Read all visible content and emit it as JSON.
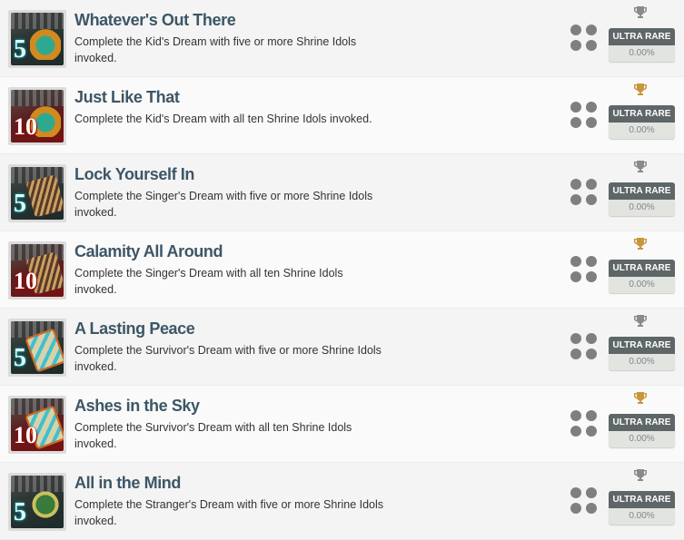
{
  "colors": {
    "trophy_silver": "#8a8a8a",
    "trophy_gold": "#c8963e",
    "badge": "#5f6668",
    "title": "#3d5666"
  },
  "achievements": [
    {
      "title": "Whatever's Out There",
      "description": "Complete the Kid's Dream with five or more Shrine Idols invoked.",
      "icon_number": "5",
      "icon_subject": "kid",
      "trophy": "silver",
      "rarity": "ULTRA RARE",
      "percent": "0.00%"
    },
    {
      "title": "Just Like That",
      "description": "Complete the Kid's Dream with all ten Shrine Idols invoked.",
      "icon_number": "10",
      "icon_subject": "kid",
      "trophy": "gold",
      "rarity": "ULTRA RARE",
      "percent": "0.00%"
    },
    {
      "title": "Lock Yourself In",
      "description": "Complete the Singer's Dream with five or more Shrine Idols invoked.",
      "icon_number": "5",
      "icon_subject": "singer",
      "trophy": "silver",
      "rarity": "ULTRA RARE",
      "percent": "0.00%"
    },
    {
      "title": "Calamity All Around",
      "description": "Complete the Singer's Dream with all ten Shrine Idols invoked.",
      "icon_number": "10",
      "icon_subject": "singer",
      "trophy": "gold",
      "rarity": "ULTRA RARE",
      "percent": "0.00%"
    },
    {
      "title": "A Lasting Peace",
      "description": "Complete the Survivor's Dream with five or more Shrine Idols invoked.",
      "icon_number": "5",
      "icon_subject": "surv",
      "trophy": "silver",
      "rarity": "ULTRA RARE",
      "percent": "0.00%"
    },
    {
      "title": "Ashes in the Sky",
      "description": "Complete the Survivor's Dream with all ten Shrine Idols invoked.",
      "icon_number": "10",
      "icon_subject": "surv",
      "trophy": "gold",
      "rarity": "ULTRA RARE",
      "percent": "0.00%"
    },
    {
      "title": "All in the Mind",
      "description": "Complete the Stranger's Dream with five or more Shrine Idols invoked.",
      "icon_number": "5",
      "icon_subject": "stranger",
      "trophy": "silver",
      "rarity": "ULTRA RARE",
      "percent": "0.00%"
    }
  ]
}
